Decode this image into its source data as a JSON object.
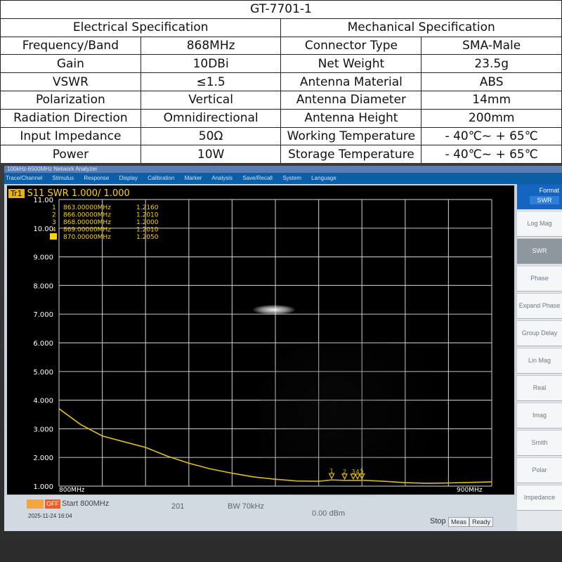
{
  "spec_table": {
    "title": "GT-7701-1",
    "electrical_header": "Electrical Specification",
    "mechanical_header": "Mechanical Specification",
    "rows": [
      {
        "e_label": "Frequency/Band",
        "e_value": "868MHz",
        "m_label": "Connector Type",
        "m_value": "SMA-Male"
      },
      {
        "e_label": "Gain",
        "e_value": "10DBi",
        "m_label": "Net Weight",
        "m_value": "23.5g"
      },
      {
        "e_label": "VSWR",
        "e_value": "≤1.5",
        "m_label": "Antenna Material",
        "m_value": "ABS"
      },
      {
        "e_label": "Polarization",
        "e_value": "Vertical",
        "m_label": "Antenna Diameter",
        "m_value": "14mm"
      },
      {
        "e_label": "Radiation Direction",
        "e_value": "Omnidirectional",
        "m_label": "Antenna Height",
        "m_value": "200mm"
      },
      {
        "e_label": "Input Impedance",
        "e_value": "50Ω",
        "m_label": "Working Temperature",
        "m_value": "- 40℃~ + 65℃"
      },
      {
        "e_label": "Power",
        "e_value": "10W",
        "m_label": "Storage Temperature",
        "m_value": "- 40℃~ + 65℃"
      }
    ]
  },
  "analyzer": {
    "window_title": "100kHz-6500MHz Network Analyzer",
    "menu": [
      "Trace/Channel",
      "Stimulus",
      "Response",
      "Display",
      "Calibration",
      "Marker",
      "Analysis",
      "Save/Recall",
      "System",
      "Language"
    ],
    "trace_label": "Tr1",
    "trace_title": "S11 SWR 1.000/ 1.000",
    "markers": [
      {
        "id": "1",
        "freq": "863.00000MHz",
        "value": "1.2160"
      },
      {
        "id": "2",
        "freq": "866.00000MHz",
        "value": "1.2010"
      },
      {
        "id": "3",
        "freq": "868.00000MHz",
        "value": "1.2000"
      },
      {
        "id": "4",
        "freq": "869.00000MHz",
        "value": "1.2010"
      },
      {
        "id": "",
        "freq": "870.00000MHz",
        "value": "1.2050"
      }
    ],
    "y_ticks": [
      "11.00",
      "10.00",
      "9.000",
      "8.000",
      "7.000",
      "6.000",
      "5.000",
      "4.000",
      "3.000",
      "2.000",
      "1.000"
    ],
    "x_start_label": "800MHz",
    "x_stop_label": "900MHz",
    "top_marker_label": "5",
    "softkeys": {
      "header": "Format",
      "header_value": "SWR",
      "items": [
        "Log Mag",
        "SWR",
        "Phase",
        "Expand Phase",
        "Group Delay",
        "Lin Mag",
        "Real",
        "Imag",
        "Smith",
        "Polar",
        "Impedance"
      ]
    },
    "status": {
      "off_label": "OFF",
      "start": "Start 800MHz",
      "points": "201",
      "bandwidth": "BW 70kHz",
      "power": "0.00 dBm",
      "stop": "Stop 900MHz",
      "timestamp": "2025-11-24 16:04",
      "meas_button": "Meas",
      "ready_button": "Ready"
    },
    "colors": {
      "trace": "#e0c020",
      "grid": "#cfcfcf",
      "label": "#ffd400"
    }
  },
  "chart_data": {
    "type": "line",
    "title": "S11 SWR 1.000/ 1.000",
    "xlabel": "",
    "ylabel": "",
    "xlim": [
      800,
      900
    ],
    "ylim": [
      1.0,
      11.0
    ],
    "grid": true,
    "series": [
      {
        "name": "S11 SWR",
        "x": [
          800,
          805,
          810,
          815,
          820,
          825,
          830,
          835,
          840,
          845,
          850,
          855,
          860,
          863,
          866,
          868,
          869,
          870,
          875,
          880,
          885,
          890,
          895,
          900
        ],
        "values": [
          3.7,
          3.15,
          2.75,
          2.55,
          2.35,
          2.05,
          1.8,
          1.6,
          1.45,
          1.32,
          1.24,
          1.18,
          1.17,
          1.216,
          1.201,
          1.2,
          1.201,
          1.205,
          1.17,
          1.12,
          1.1,
          1.11,
          1.13,
          1.15
        ]
      }
    ],
    "markers": [
      {
        "x": 863,
        "y": 1.216
      },
      {
        "x": 866,
        "y": 1.201
      },
      {
        "x": 868,
        "y": 1.2
      },
      {
        "x": 869,
        "y": 1.201
      },
      {
        "x": 870,
        "y": 1.205
      }
    ]
  }
}
